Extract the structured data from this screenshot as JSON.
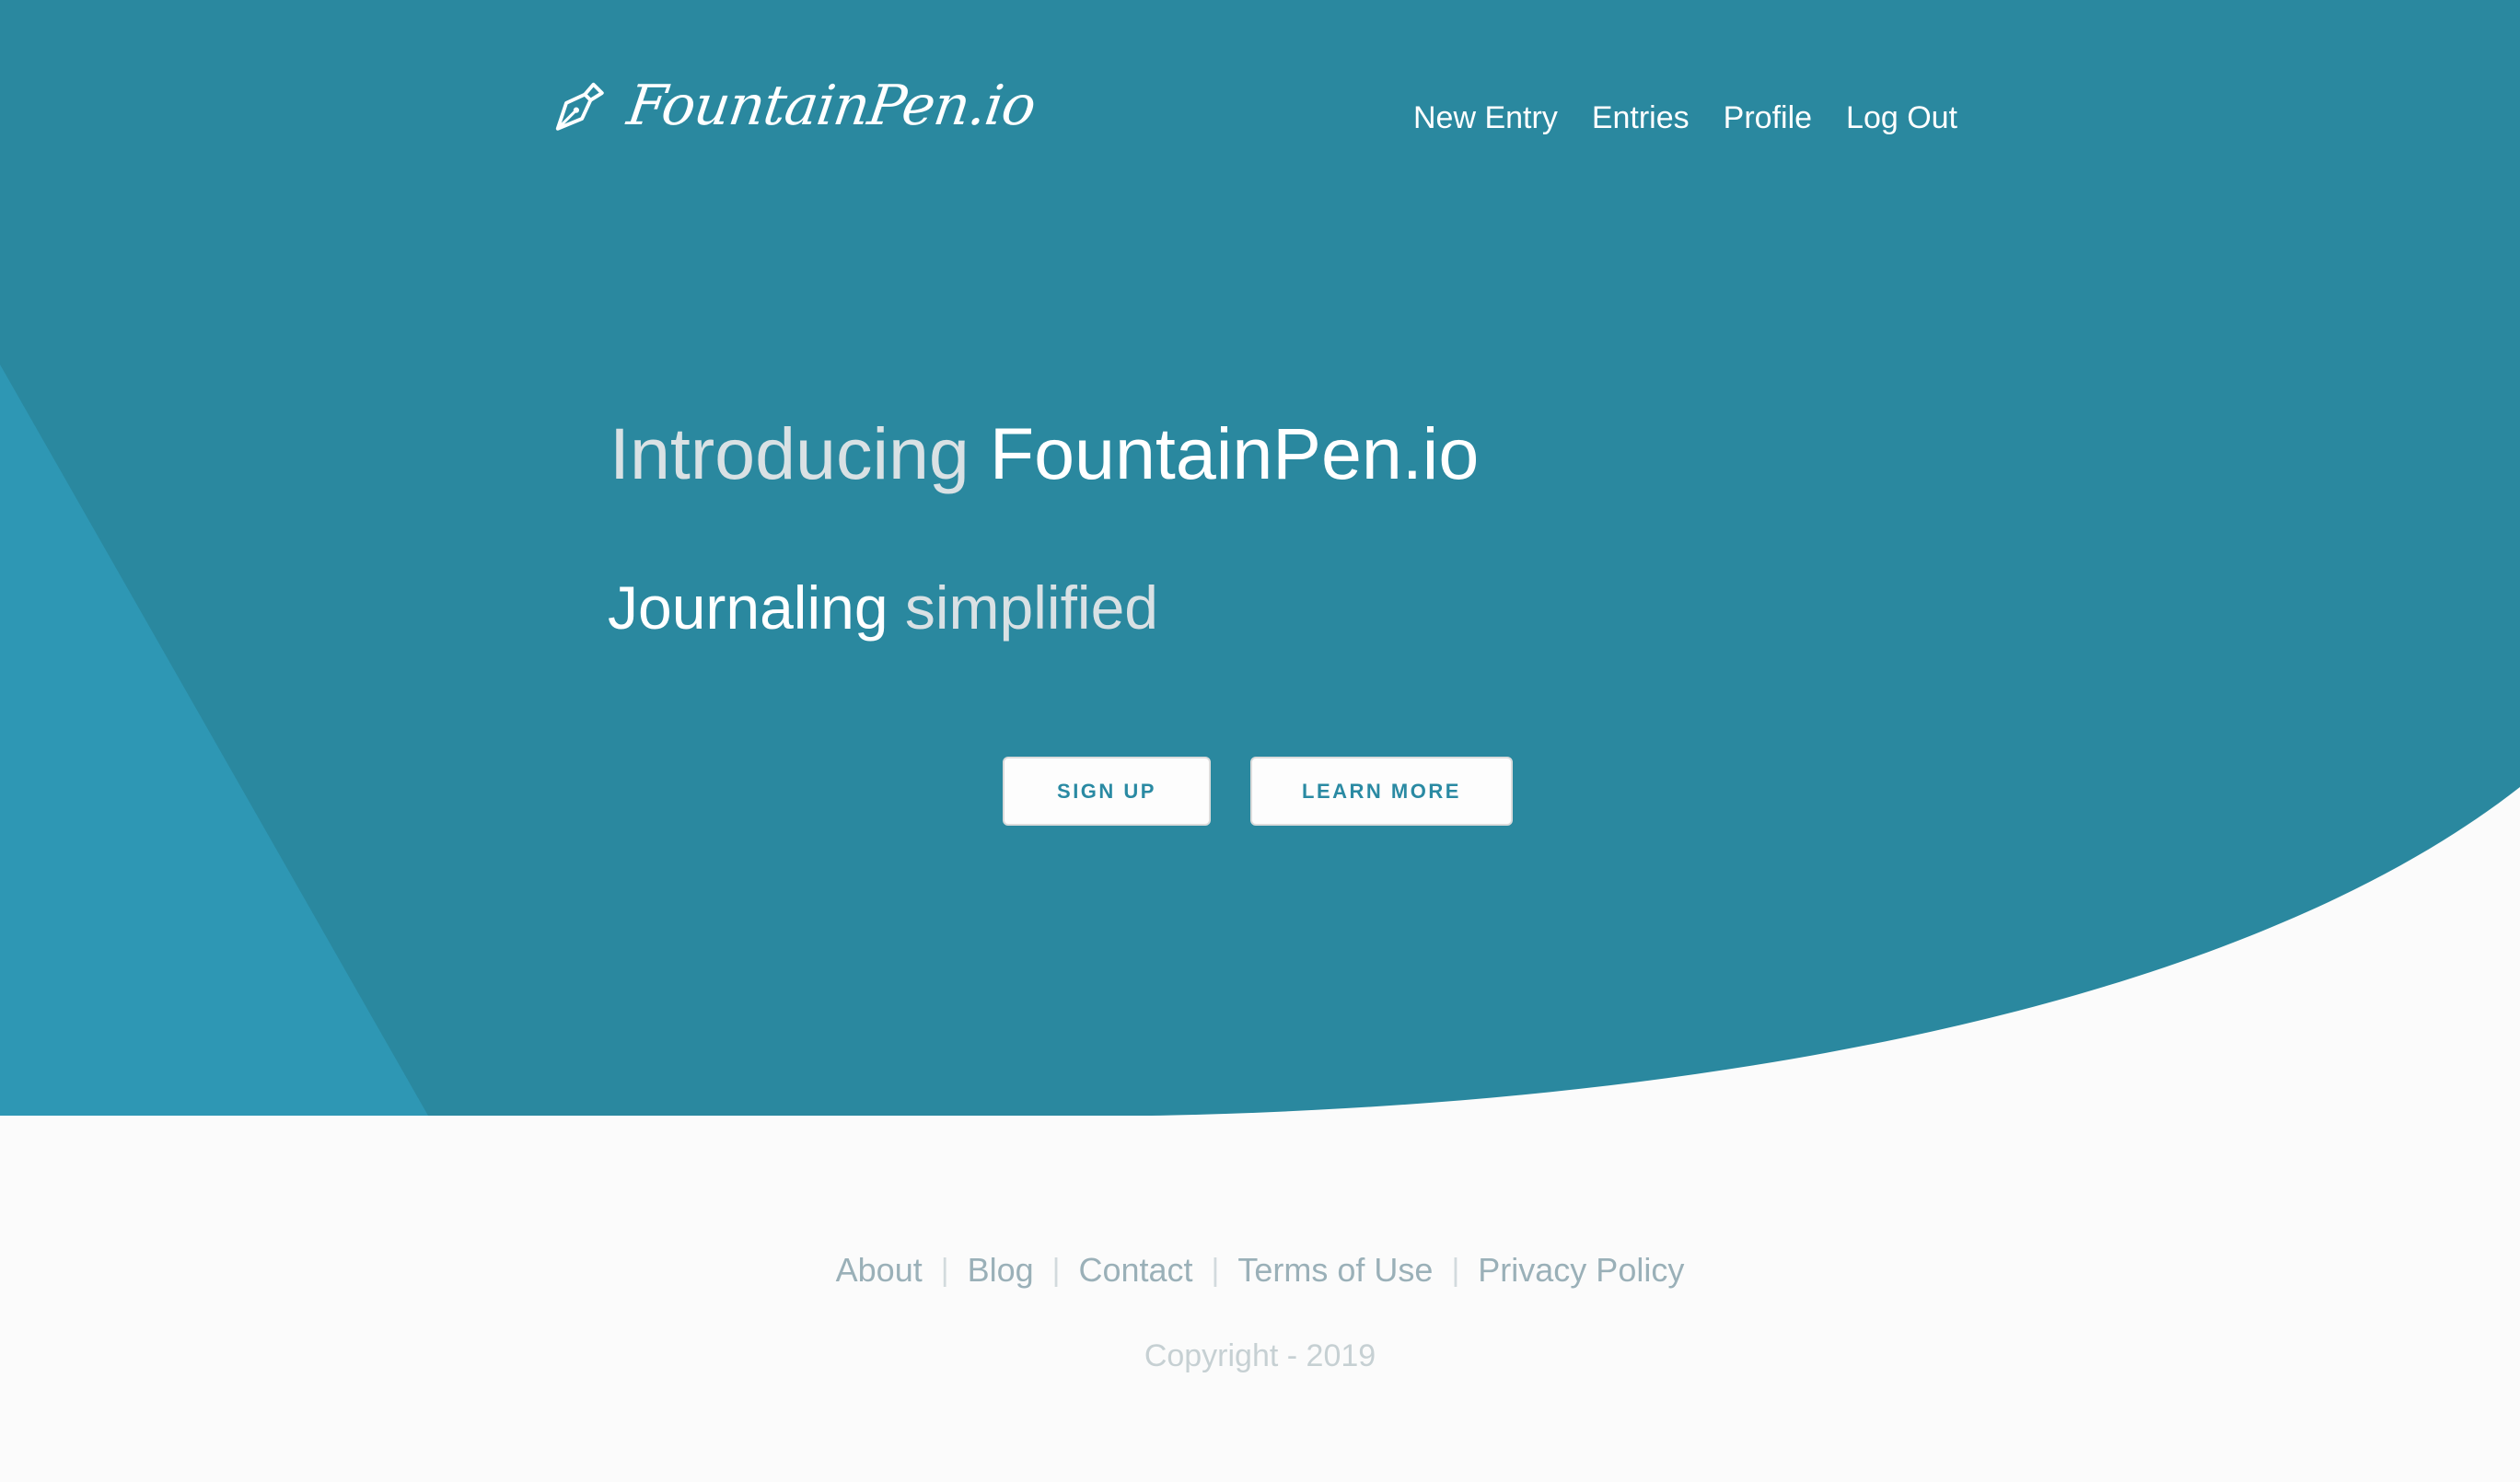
{
  "colors": {
    "hero_bg": "#2a889f",
    "hero_triangle": "#2e97b4",
    "page_bg": "#fbfbfb",
    "button_text": "#2a8aa3",
    "footer_link": "#9ab0b8",
    "copyright": "#c6d0d3"
  },
  "header": {
    "logo_icon": "fountain-pen-nib-icon",
    "logo_text": "FountainPen.io",
    "nav": [
      {
        "label": "New Entry"
      },
      {
        "label": "Entries"
      },
      {
        "label": "Profile"
      },
      {
        "label": "Log Out"
      }
    ]
  },
  "hero": {
    "headline_light": "Introducing",
    "headline_strong": "FountainPen.io",
    "subhead_strong": "Journaling",
    "subhead_light": "simplified",
    "buttons": {
      "signup": "SIGN UP",
      "learn_more": "LEARN MORE"
    }
  },
  "footer": {
    "links": [
      {
        "label": "About"
      },
      {
        "label": "Blog"
      },
      {
        "label": "Contact"
      },
      {
        "label": "Terms of Use"
      },
      {
        "label": "Privacy Policy"
      }
    ],
    "separator": "|",
    "copyright": "Copyright - 2019"
  }
}
